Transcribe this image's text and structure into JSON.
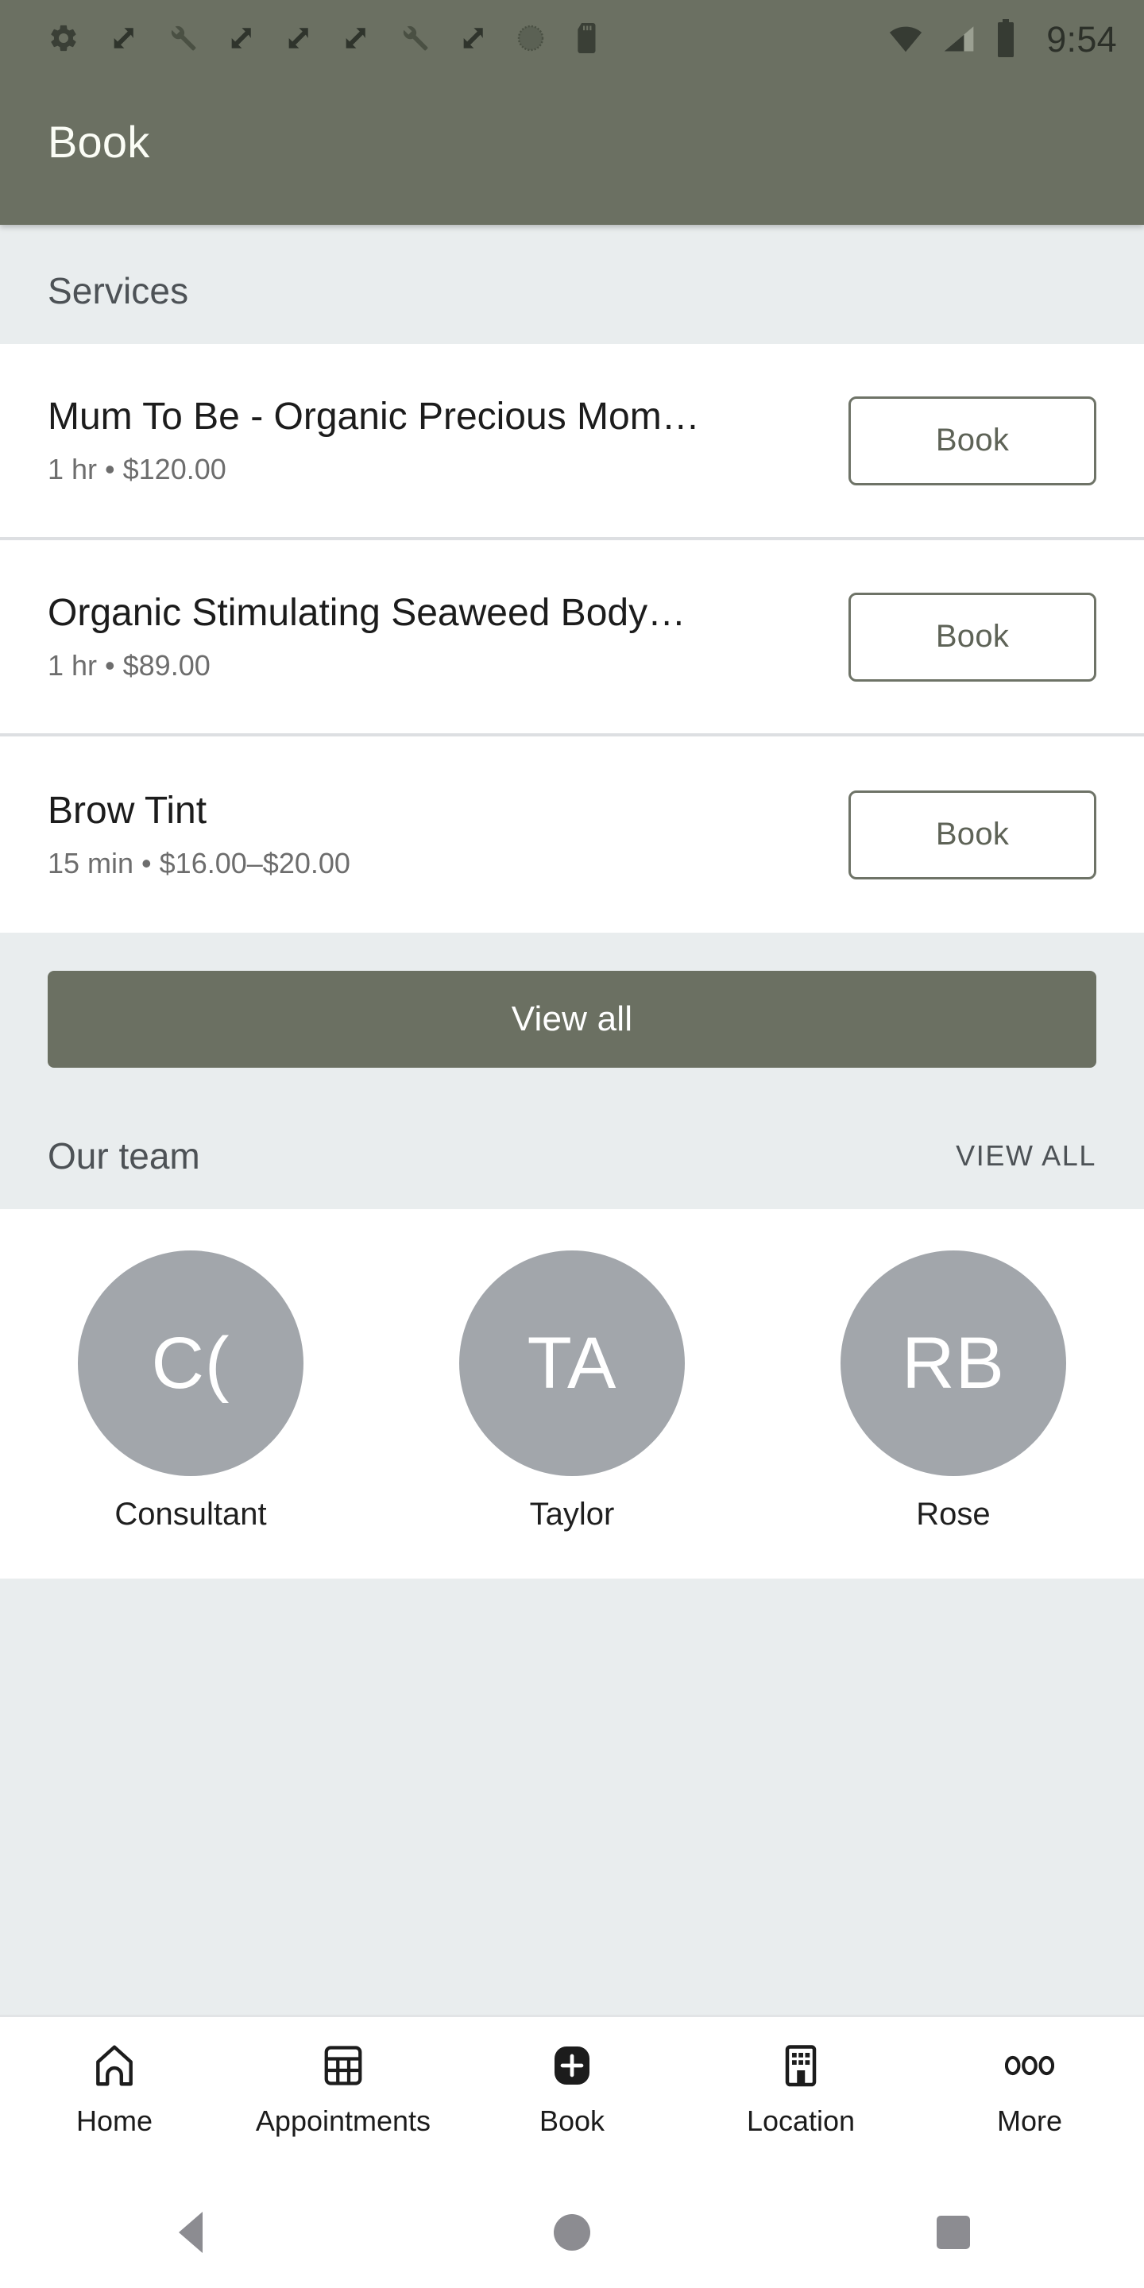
{
  "statusbar": {
    "icons": [
      "gear-icon",
      "resize-icon",
      "wrench-icon",
      "resize-icon",
      "resize-icon",
      "resize-icon",
      "wrench-icon",
      "resize-icon",
      "circle-dotted-icon",
      "sdcard-icon"
    ],
    "wifi": "wifi-icon",
    "signal": "cellular-signal-icon",
    "battery": "battery-full-icon",
    "time": "9:54"
  },
  "appbar": {
    "title": "Book",
    "background": "#6b7062",
    "text_color": "#fbfdf6"
  },
  "services_section": {
    "title": "Services",
    "items": [
      {
        "name": "Mum To Be - Organic Precious Mom…",
        "meta": "1 hr • $120.00",
        "duration": "1 hr",
        "price": "$120.00",
        "action": "Book"
      },
      {
        "name": "Organic Stimulating Seaweed Body…",
        "meta": "1 hr • $89.00",
        "duration": "1 hr",
        "price": "$89.00",
        "action": "Book"
      },
      {
        "name": "Brow Tint",
        "meta": "15 min • $16.00–$20.00",
        "duration": "15 min",
        "price": "$16.00–$20.00",
        "action": "Book"
      }
    ],
    "view_all_button": "View all"
  },
  "team_section": {
    "title": "Our team",
    "view_all_link": "VIEW ALL",
    "members": [
      {
        "initials": "C(",
        "name": "Consultant"
      },
      {
        "initials": "TA",
        "name": "Taylor"
      },
      {
        "initials": "RB",
        "name": "Rose"
      }
    ],
    "avatar_color": "#a2a6ab"
  },
  "bottom_nav": {
    "items": [
      {
        "label": "Home",
        "icon": "home-icon"
      },
      {
        "label": "Appointments",
        "icon": "calendar-grid-icon"
      },
      {
        "label": "Book",
        "icon": "plus-square-icon"
      },
      {
        "label": "Location",
        "icon": "building-icon"
      },
      {
        "label": "More",
        "icon": "more-dots-icon"
      }
    ],
    "active": "Book"
  },
  "system_nav": {
    "back": "back-triangle-icon",
    "home": "home-circle-icon",
    "recents": "recents-square-icon"
  },
  "colors": {
    "accent": "#6b7062",
    "section_bg": "#e9edee",
    "card_bg": "#ffffff",
    "divider": "#dddfe2"
  }
}
